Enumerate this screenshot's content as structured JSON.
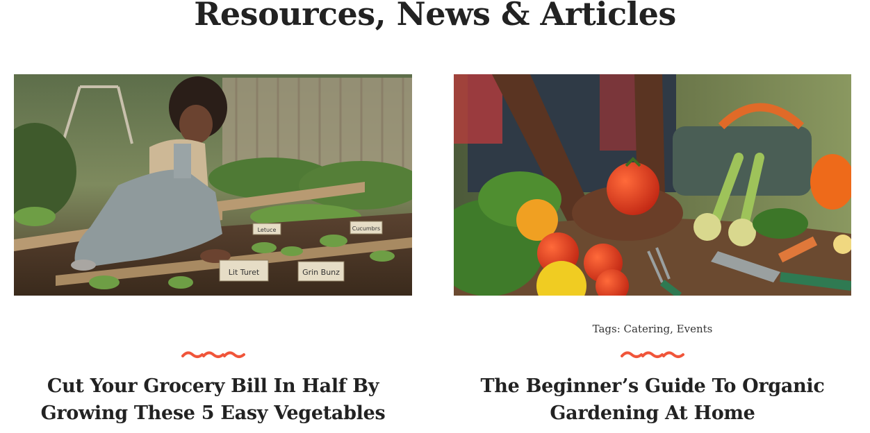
{
  "section": {
    "title": "Resources, News & Articles"
  },
  "colors": {
    "accent": "#f0553a",
    "text": "#222222"
  },
  "posts": [
    {
      "image_alt": "Woman kneeling and planting seedlings in a raised garden bed",
      "tags_label": "",
      "tags": [],
      "title": "Cut Your Grocery Bill In Half By Growing These 5 Easy Vegetables"
    },
    {
      "image_alt": "Hands holding a ripe tomato over garden soil with vegetables and tools",
      "tags_label": "Tags:",
      "tags": [
        "Catering",
        "Events"
      ],
      "title": "The Beginner’s Guide To Organic Gardening At Home"
    }
  ],
  "image_labels": {
    "sign_1": "Lit Turet",
    "sign_2": "Grin Bunz",
    "sign_3": "Cucumbrs",
    "sign_4": "Letuce"
  }
}
